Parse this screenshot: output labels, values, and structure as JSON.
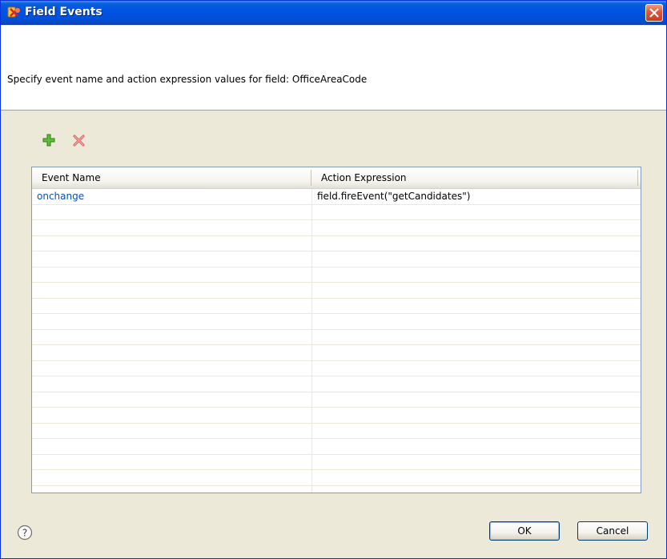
{
  "window": {
    "title": "Field Events",
    "title_icon": "field-events-app-icon",
    "close_icon": "close-icon"
  },
  "header": {
    "description": "Specify event name and action expression values for field: OfficeAreaCode"
  },
  "toolbar": {
    "add_icon": "add-icon",
    "delete_icon": "delete-icon"
  },
  "table": {
    "columns": [
      "Event Name",
      "Action Expression"
    ],
    "rows": [
      {
        "event_name": "onchange",
        "action_expression": "field.fireEvent(\"getCandidates\")"
      }
    ]
  },
  "footer": {
    "help_icon": "help-icon",
    "ok_label": "OK",
    "cancel_label": "Cancel"
  },
  "colors": {
    "titlebar": "#0054e3",
    "link_text": "#0b4fbf",
    "close_button": "#e0553a"
  }
}
